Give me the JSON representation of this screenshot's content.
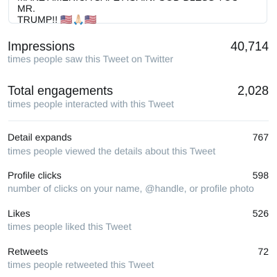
{
  "tweet": {
    "text_line1": "MAKE AMERICA SAFE AGAIN! GOD BLESS YOU MR.",
    "text_line2": "TRUMP!! 🇺🇸🙏🏻🇺🇸"
  },
  "metrics": {
    "impressions": {
      "label": "Impressions",
      "value": "40,714",
      "description": "times people saw this Tweet on Twitter"
    },
    "total_engagements": {
      "label": "Total engagements",
      "value": "2,028",
      "description": "times people interacted with this Tweet"
    },
    "detail_expands": {
      "label": "Detail expands",
      "value": "767",
      "description": "times people viewed the details about this Tweet"
    },
    "profile_clicks": {
      "label": "Profile clicks",
      "value": "598",
      "description": "number of clicks on your name, @handle, or profile photo"
    },
    "likes": {
      "label": "Likes",
      "value": "526",
      "description": "times people liked this Tweet"
    },
    "retweets": {
      "label": "Retweets",
      "value": "72",
      "description": "times people retweeted this Tweet"
    }
  }
}
